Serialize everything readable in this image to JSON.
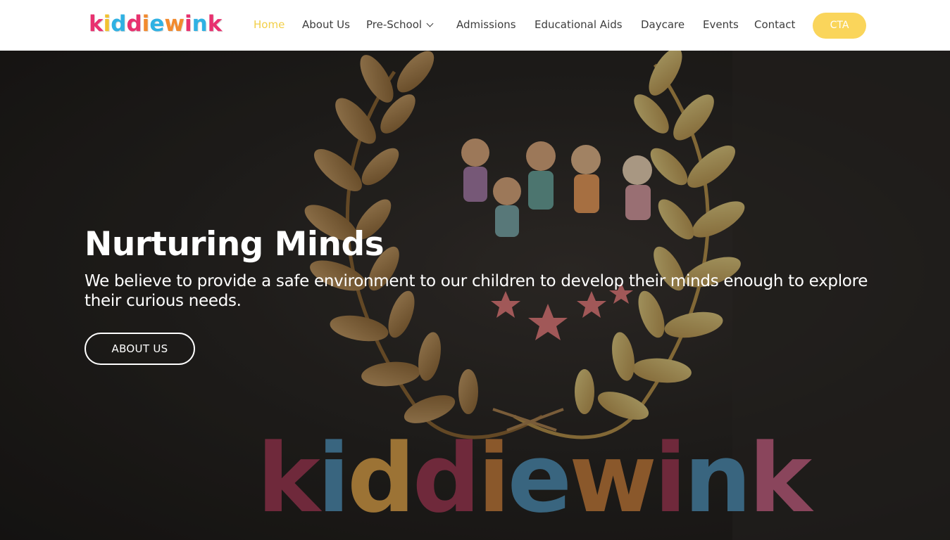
{
  "header": {
    "logo_letters": [
      {
        "ch": "k",
        "color": "#e8316f"
      },
      {
        "ch": "i",
        "color": "#f2c230"
      },
      {
        "ch": "d",
        "color": "#2fb1e3"
      },
      {
        "ch": "d",
        "color": "#e8316f"
      },
      {
        "ch": "i",
        "color": "#f28a2e"
      },
      {
        "ch": "e",
        "color": "#2fb1e3"
      },
      {
        "ch": "w",
        "color": "#f28a2e"
      },
      {
        "ch": "i",
        "color": "#e8316f"
      },
      {
        "ch": "n",
        "color": "#2fb1e3"
      },
      {
        "ch": "k",
        "color": "#e8316f"
      }
    ],
    "logo_text": "kiddiewink",
    "nav": {
      "home": "Home",
      "about": "About Us",
      "preschool": "Pre-School",
      "admissions": "Admissions",
      "aids": "Educational Aids",
      "daycare": "Daycare",
      "events": "Events",
      "contact": "Contact"
    },
    "cta_label": "CTA",
    "active_color": "#f2cf48",
    "cta_color": "#fad55b"
  },
  "hero": {
    "title": "Nurturing Minds",
    "subtitle": "We believe to provide a safe environment to our children to develop their minds enough to explore their curious needs.",
    "button_label": "ABOUT US",
    "sign_text": "kiddiewink"
  }
}
